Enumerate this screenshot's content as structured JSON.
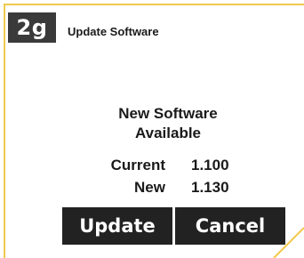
{
  "step_badge": "2g",
  "screen_title": "Update Software",
  "message": {
    "line1": "New Software",
    "line2": "Available"
  },
  "versions": {
    "current_label": "Current",
    "current_value": "1.100",
    "new_label": "New",
    "new_value": "1.130"
  },
  "buttons": {
    "update_label": "Update",
    "cancel_label": "Cancel"
  },
  "colors": {
    "accent_border": "#f2c94c",
    "badge_bg": "#3a3a3a",
    "button_bg": "#222222"
  }
}
